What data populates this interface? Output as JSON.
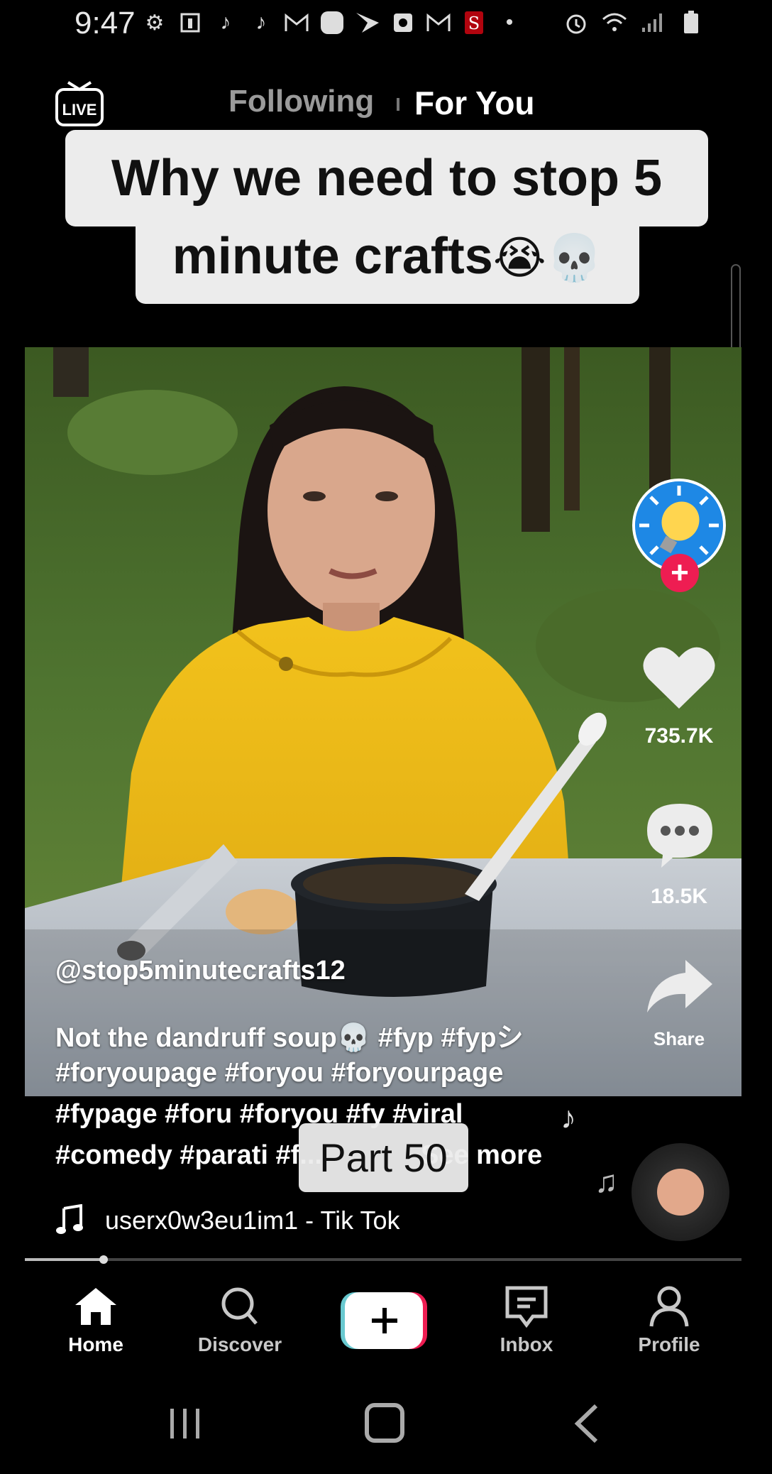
{
  "status_bar": {
    "time": "9:47",
    "left_icons": [
      "settings-icon",
      "news-icon",
      "tiktok-icon",
      "tiktok-icon",
      "gmail-icon",
      "app-icon",
      "sprint-icon",
      "app-icon",
      "gmail-icon",
      "stanford-icon",
      "dot-icon"
    ],
    "right_icons": [
      "alarm-icon",
      "wifi-icon",
      "signal-icon",
      "battery-icon"
    ]
  },
  "top_nav": {
    "live_label": "LIVE",
    "tabs": [
      {
        "label": "Following",
        "active": false
      },
      {
        "label": "For You",
        "active": true
      }
    ]
  },
  "caption": {
    "line1": "Why we need to stop 5",
    "line2": "minute crafts",
    "line2_emoji": "😭💀"
  },
  "rail": {
    "likes": "735.7K",
    "comments": "18.5K",
    "share_label": "Share"
  },
  "post": {
    "username": "@stop5minutecrafts12",
    "description_lines": [
      "Not the dandruff soup💀 #fyp #fypシ",
      "#foryoupage #foryou #foryourpage",
      "#fypage #foru #foryou #fy #viral",
      "#comedy #parati #f..."
    ],
    "see_more": "See more",
    "part_label": "Part 50",
    "sound": "userx0w3eu1im1 - Tik Tok"
  },
  "playback": {
    "progress_fraction": 0.11
  },
  "bottom_nav": {
    "items": [
      {
        "label": "Home",
        "icon": "home-icon",
        "active": true
      },
      {
        "label": "Discover",
        "icon": "search-icon",
        "active": false
      },
      {
        "label": "",
        "icon": "plus-icon",
        "active": false
      },
      {
        "label": "Inbox",
        "icon": "inbox-icon",
        "active": false
      },
      {
        "label": "Profile",
        "icon": "profile-icon",
        "active": false
      }
    ]
  },
  "colors": {
    "background": "#000000",
    "accent_red": "#ee1d52",
    "accent_cyan": "#69c9d0",
    "caption_bg": "#ececec"
  }
}
